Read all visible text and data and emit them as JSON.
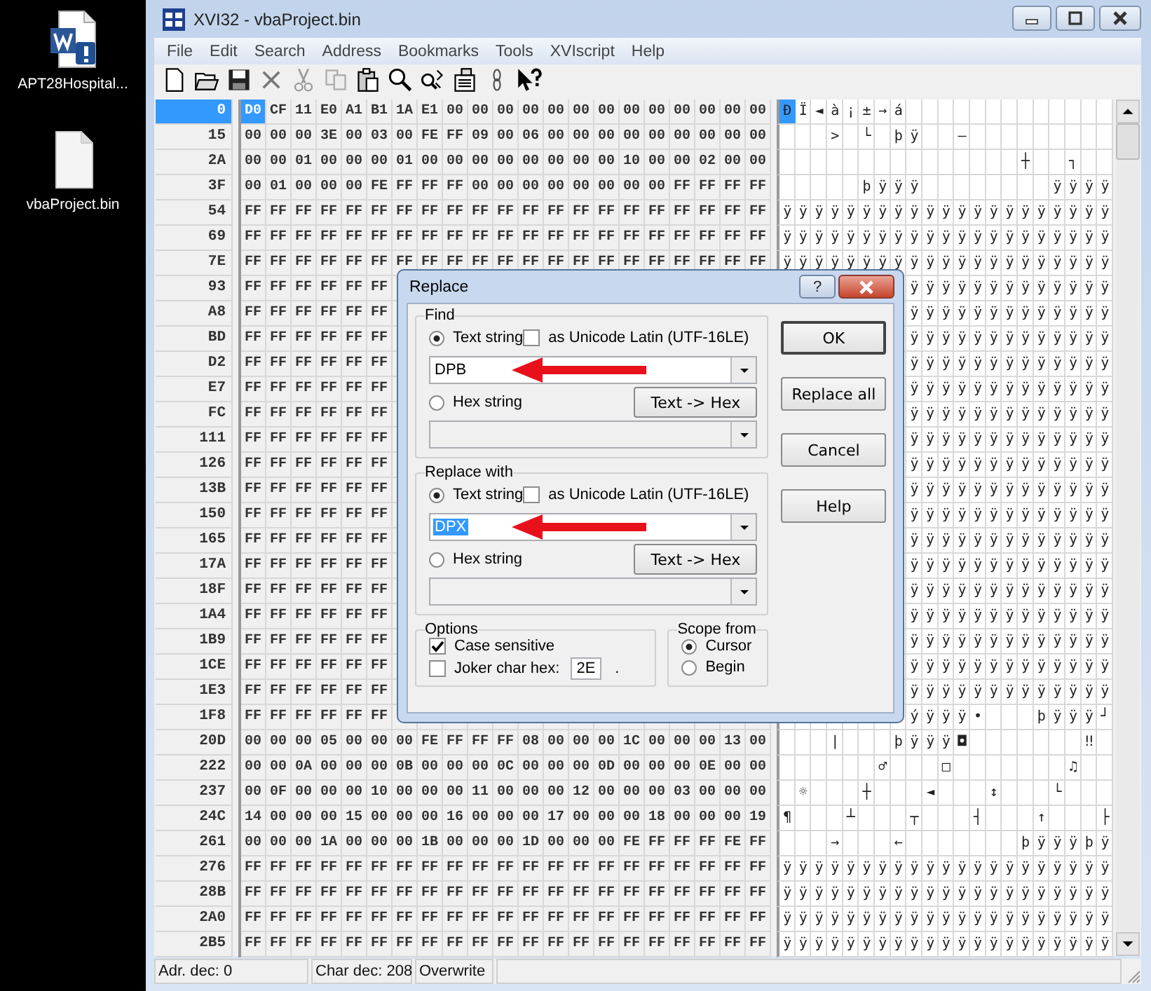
{
  "desktop": {
    "icons": [
      {
        "kind": "word",
        "label": "APT28Hospital..."
      },
      {
        "kind": "file",
        "label": "vbaProject.bin"
      }
    ]
  },
  "window": {
    "title": "XVI32 - vbaProject.bin"
  },
  "menu": [
    "File",
    "Edit",
    "Search",
    "Address",
    "Bookmarks",
    "Tools",
    "XVIscript",
    "Help"
  ],
  "rows": [
    {
      "address": "0",
      "selected": true,
      "hex": [
        "D0",
        "CF",
        "11",
        "E0",
        "A1",
        "B1",
        "1A",
        "E1",
        "00",
        "00",
        "00",
        "00",
        "00",
        "00",
        "00",
        "00",
        "00",
        "00",
        "00",
        "00",
        "00"
      ],
      "chars": "ÐÏ◄à¡±→á             "
    },
    {
      "address": "15",
      "selected": false,
      "hex": [
        "00",
        "00",
        "00",
        "3E",
        "00",
        "03",
        "00",
        "FE",
        "FF",
        "09",
        "00",
        "06",
        "00",
        "00",
        "00",
        "00",
        "00",
        "00",
        "00",
        "00",
        "00"
      ],
      "chars": "   > └ þÿ  –         "
    },
    {
      "address": "2A",
      "selected": false,
      "hex": [
        "00",
        "00",
        "01",
        "00",
        "00",
        "00",
        "01",
        "00",
        "00",
        "00",
        "00",
        "00",
        "00",
        "00",
        "00",
        "10",
        "00",
        "00",
        "02",
        "00",
        "00"
      ],
      "chars": "               ┼  ┐  "
    },
    {
      "address": "3F",
      "selected": false,
      "hex": [
        "00",
        "01",
        "00",
        "00",
        "00",
        "FE",
        "FF",
        "FF",
        "FF",
        "00",
        "00",
        "00",
        "00",
        "00",
        "00",
        "00",
        "00",
        "FF",
        "FF",
        "FF",
        "FF"
      ],
      "chars": "     þÿÿÿ        ÿÿÿÿ"
    },
    {
      "address": "54",
      "selected": false,
      "hex": [
        "FF",
        "FF",
        "FF",
        "FF",
        "FF",
        "FF",
        "FF",
        "FF",
        "FF",
        "FF",
        "FF",
        "FF",
        "FF",
        "FF",
        "FF",
        "FF",
        "FF",
        "FF",
        "FF",
        "FF",
        "FF"
      ],
      "chars": "ÿÿÿÿÿÿÿÿÿÿÿÿÿÿÿÿÿÿÿÿÿ"
    },
    {
      "address": "69",
      "selected": false,
      "hex": [
        "FF",
        "FF",
        "FF",
        "FF",
        "FF",
        "FF",
        "FF",
        "FF",
        "FF",
        "FF",
        "FF",
        "FF",
        "FF",
        "FF",
        "FF",
        "FF",
        "FF",
        "FF",
        "FF",
        "FF",
        "FF"
      ],
      "chars": "ÿÿÿÿÿÿÿÿÿÿÿÿÿÿÿÿÿÿÿÿÿ"
    },
    {
      "address": "7E",
      "selected": false,
      "hex": [
        "FF",
        "FF",
        "FF",
        "FF",
        "FF",
        "FF",
        "FF",
        "FF",
        "FF",
        "FF",
        "FF",
        "FF",
        "FF",
        "FF",
        "FF",
        "FF",
        "FF",
        "FF",
        "FF",
        "FF",
        "FF"
      ],
      "chars": "ÿÿÿÿÿÿÿÿÿÿÿÿÿÿÿÿÿÿÿÿÿ"
    },
    {
      "address": "93",
      "selected": false,
      "hex": [
        "FF",
        "FF",
        "FF",
        "FF",
        "FF",
        "FF"
      ],
      "chars": "ÿÿÿÿÿÿÿÿÿÿÿÿÿ"
    },
    {
      "address": "A8",
      "selected": false,
      "hex": [
        "FF",
        "FF",
        "FF",
        "FF",
        "FF",
        "FF"
      ],
      "chars": "ÿÿÿÿÿÿÿÿÿÿÿÿÿ"
    },
    {
      "address": "BD",
      "selected": false,
      "hex": [
        "FF",
        "FF",
        "FF",
        "FF",
        "FF",
        "FF"
      ],
      "chars": "ÿÿÿÿÿÿÿÿÿÿÿÿÿ"
    },
    {
      "address": "D2",
      "selected": false,
      "hex": [
        "FF",
        "FF",
        "FF",
        "FF",
        "FF",
        "FF"
      ],
      "chars": "ÿÿÿÿÿÿÿÿÿÿÿÿÿ"
    },
    {
      "address": "E7",
      "selected": false,
      "hex": [
        "FF",
        "FF",
        "FF",
        "FF",
        "FF",
        "FF"
      ],
      "chars": "ÿÿÿÿÿÿÿÿÿÿÿÿÿ"
    },
    {
      "address": "FC",
      "selected": false,
      "hex": [
        "FF",
        "FF",
        "FF",
        "FF",
        "FF",
        "FF"
      ],
      "chars": "ÿÿÿÿÿÿÿÿÿÿÿÿÿ"
    },
    {
      "address": "111",
      "selected": false,
      "hex": [
        "FF",
        "FF",
        "FF",
        "FF",
        "FF",
        "FF"
      ],
      "chars": "ÿÿÿÿÿÿÿÿÿÿÿÿÿ"
    },
    {
      "address": "126",
      "selected": false,
      "hex": [
        "FF",
        "FF",
        "FF",
        "FF",
        "FF",
        "FF"
      ],
      "chars": "ÿÿÿÿÿÿÿÿÿÿÿÿÿ"
    },
    {
      "address": "13B",
      "selected": false,
      "hex": [
        "FF",
        "FF",
        "FF",
        "FF",
        "FF",
        "FF"
      ],
      "chars": "ÿÿÿÿÿÿÿÿÿÿÿÿÿ"
    },
    {
      "address": "150",
      "selected": false,
      "hex": [
        "FF",
        "FF",
        "FF",
        "FF",
        "FF",
        "FF"
      ],
      "chars": "ÿÿÿÿÿÿÿÿÿÿÿÿÿ"
    },
    {
      "address": "165",
      "selected": false,
      "hex": [
        "FF",
        "FF",
        "FF",
        "FF",
        "FF",
        "FF"
      ],
      "chars": "ÿÿÿÿÿÿÿÿÿÿÿÿÿ"
    },
    {
      "address": "17A",
      "selected": false,
      "hex": [
        "FF",
        "FF",
        "FF",
        "FF",
        "FF",
        "FF"
      ],
      "chars": "ÿÿÿÿÿÿÿÿÿÿÿÿÿ"
    },
    {
      "address": "18F",
      "selected": false,
      "hex": [
        "FF",
        "FF",
        "FF",
        "FF",
        "FF",
        "FF"
      ],
      "chars": "ÿÿÿÿÿÿÿÿÿÿÿÿÿ"
    },
    {
      "address": "1A4",
      "selected": false,
      "hex": [
        "FF",
        "FF",
        "FF",
        "FF",
        "FF",
        "FF"
      ],
      "chars": "ÿÿÿÿÿÿÿÿÿÿÿÿÿ"
    },
    {
      "address": "1B9",
      "selected": false,
      "hex": [
        "FF",
        "FF",
        "FF",
        "FF",
        "FF",
        "FF"
      ],
      "chars": "ÿÿÿÿÿÿÿÿÿÿÿÿÿ"
    },
    {
      "address": "1CE",
      "selected": false,
      "hex": [
        "FF",
        "FF",
        "FF",
        "FF",
        "FF",
        "FF"
      ],
      "chars": "ÿÿÿÿÿÿÿÿÿÿÿÿÿ"
    },
    {
      "address": "1E3",
      "selected": false,
      "hex": [
        "FF",
        "FF",
        "FF",
        "FF",
        "FF",
        "FF"
      ],
      "chars": "ÿÿÿÿÿÿÿÿÿÿÿÿÿ"
    },
    {
      "address": "1F8",
      "selected": false,
      "hex": [
        "FF",
        "FF",
        "FF",
        "FF",
        "FF",
        "FF"
      ],
      "chars": "ýÿÿÿ•   þÿÿÿ┘"
    },
    {
      "address": "20D",
      "selected": false,
      "hex": [
        "00",
        "00",
        "00",
        "05",
        "00",
        "00",
        "00",
        "FE",
        "FF",
        "FF",
        "FF",
        "08",
        "00",
        "00",
        "00",
        "1C",
        "00",
        "00",
        "00",
        "13",
        "00"
      ],
      "chars": "   |   þÿÿÿ◘       ‼ "
    },
    {
      "address": "222",
      "selected": false,
      "hex": [
        "00",
        "00",
        "0A",
        "00",
        "00",
        "00",
        "0B",
        "00",
        "00",
        "00",
        "0C",
        "00",
        "00",
        "00",
        "0D",
        "00",
        "00",
        "00",
        "0E",
        "00",
        "00"
      ],
      "chars": "      ♂   □       ♫  "
    },
    {
      "address": "237",
      "selected": false,
      "hex": [
        "00",
        "0F",
        "00",
        "00",
        "00",
        "10",
        "00",
        "00",
        "00",
        "11",
        "00",
        "00",
        "00",
        "12",
        "00",
        "00",
        "00",
        "03",
        "00",
        "00",
        "00"
      ],
      "chars": " ☼   ┼   ◄   ↕   └   "
    },
    {
      "address": "24C",
      "selected": false,
      "hex": [
        "14",
        "00",
        "00",
        "00",
        "15",
        "00",
        "00",
        "00",
        "16",
        "00",
        "00",
        "00",
        "17",
        "00",
        "00",
        "00",
        "18",
        "00",
        "00",
        "00",
        "19"
      ],
      "chars": "¶   ┴   ┬   ┤   ↑   ├"
    },
    {
      "address": "261",
      "selected": false,
      "hex": [
        "00",
        "00",
        "00",
        "1A",
        "00",
        "00",
        "00",
        "1B",
        "00",
        "00",
        "00",
        "1D",
        "00",
        "00",
        "00",
        "FE",
        "FF",
        "FF",
        "FF",
        "FE",
        "FF"
      ],
      "chars": "   →   ←       þÿÿÿþÿ"
    },
    {
      "address": "276",
      "selected": false,
      "hex": [
        "FF",
        "FF",
        "FF",
        "FF",
        "FF",
        "FF",
        "FF",
        "FF",
        "FF",
        "FF",
        "FF",
        "FF",
        "FF",
        "FF",
        "FF",
        "FF",
        "FF",
        "FF",
        "FF",
        "FF",
        "FF"
      ],
      "chars": "ÿÿÿÿÿÿÿÿÿÿÿÿÿÿÿÿÿÿÿÿÿ"
    },
    {
      "address": "28B",
      "selected": false,
      "hex": [
        "FF",
        "FF",
        "FF",
        "FF",
        "FF",
        "FF",
        "FF",
        "FF",
        "FF",
        "FF",
        "FF",
        "FF",
        "FF",
        "FF",
        "FF",
        "FF",
        "FF",
        "FF",
        "FF",
        "FF",
        "FF"
      ],
      "chars": "ÿÿÿÿÿÿÿÿÿÿÿÿÿÿÿÿÿÿÿÿÿ"
    },
    {
      "address": "2A0",
      "selected": false,
      "hex": [
        "FF",
        "FF",
        "FF",
        "FF",
        "FF",
        "FF",
        "FF",
        "FF",
        "FF",
        "FF",
        "FF",
        "FF",
        "FF",
        "FF",
        "FF",
        "FF",
        "FF",
        "FF",
        "FF",
        "FF",
        "FF"
      ],
      "chars": "ÿÿÿÿÿÿÿÿÿÿÿÿÿÿÿÿÿÿÿÿÿ"
    },
    {
      "address": "2B5",
      "selected": false,
      "hex": [
        "FF",
        "FF",
        "FF",
        "FF",
        "FF",
        "FF",
        "FF",
        "FF",
        "FF",
        "FF",
        "FF",
        "FF",
        "FF",
        "FF",
        "FF",
        "FF",
        "FF",
        "FF",
        "FF",
        "FF",
        "FF"
      ],
      "chars": "ÿÿÿÿÿÿÿÿÿÿÿÿÿÿÿÿÿÿÿÿÿ"
    }
  ],
  "status_bar": [
    "Adr. dec: 0",
    "Char dec: 208",
    "Overwrite"
  ],
  "dialog": {
    "title": "Replace",
    "help_button": "?",
    "groups": [
      {
        "label": "Find",
        "text_option": {
          "label": "Text string",
          "selected": true
        },
        "unicode": {
          "label": "as Unicode Latin (UTF-16LE)",
          "checked": false
        },
        "value": "DPB",
        "value_highlighted": false,
        "hex_option": {
          "label": "Hex string",
          "selected": false
        },
        "convert_button": "Text -> Hex"
      },
      {
        "label": "Replace with",
        "text_option": {
          "label": "Text string",
          "selected": true
        },
        "unicode": {
          "label": "as Unicode Latin (UTF-16LE)",
          "checked": false
        },
        "value": "DPX",
        "value_highlighted": true,
        "hex_option": {
          "label": "Hex string",
          "selected": false
        },
        "convert_button": "Text -> Hex"
      }
    ],
    "options": {
      "label": "Options",
      "case_sensitive": {
        "label": "Case sensitive",
        "checked": true
      },
      "joker": {
        "label": "Joker char hex:",
        "checked": false,
        "value": "2E",
        "suffix": "."
      }
    },
    "scope": {
      "label": "Scope from",
      "choices": [
        {
          "label": "Cursor",
          "selected": true
        },
        {
          "label": "Begin",
          "selected": false
        }
      ]
    },
    "buttons": [
      "OK",
      "Replace all",
      "Cancel",
      "Help"
    ]
  }
}
